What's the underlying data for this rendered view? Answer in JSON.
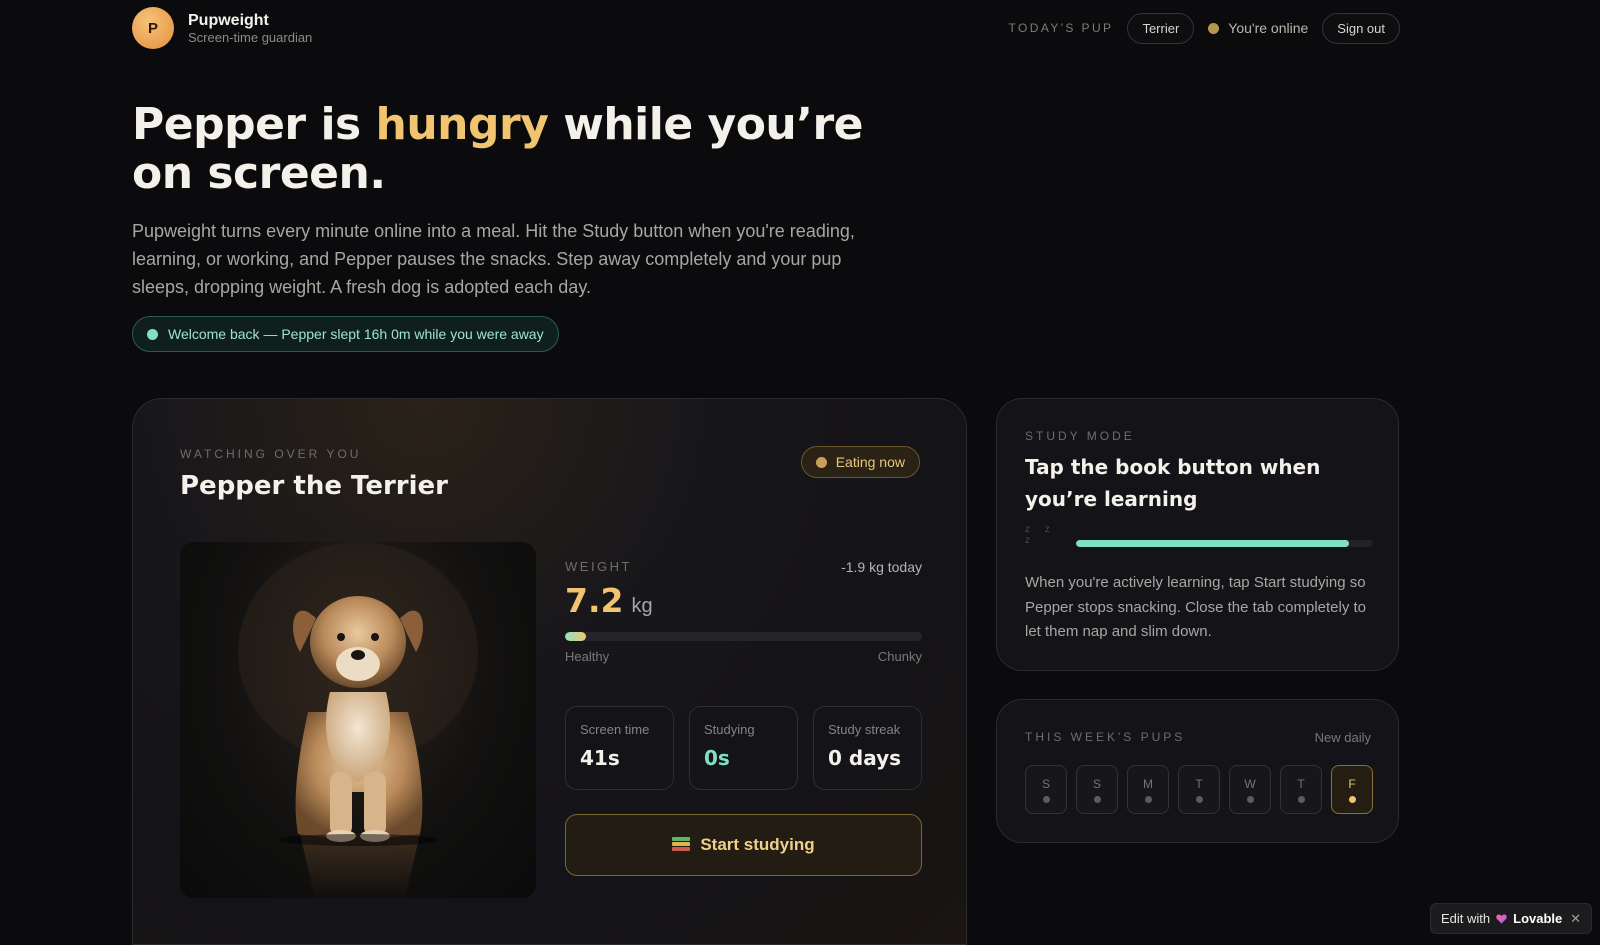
{
  "header": {
    "brand_initial": "P",
    "brand_name": "Pupweight",
    "brand_tagline": "Screen-time guardian",
    "todays_pup_label": "TODAY'S PUP",
    "breed_pill": "Terrier",
    "online_status": "You're online",
    "sign_out_label": "Sign out"
  },
  "hero": {
    "title_start": "Pepper is ",
    "title_accent": "hungry",
    "title_end": " while you’re on screen.",
    "subtitle": "Pupweight turns every minute online into a meal. Hit the Study button when you're reading, learning, or working, and Pepper pauses the snacks. Step away completely and your pup sleeps, dropping weight. A fresh dog is adopted each day.",
    "welcome_message": "Welcome back — Pepper slept 16h 0m while you were away"
  },
  "pet_card": {
    "eyebrow": "WATCHING OVER YOU",
    "pet_name": "Pepper the Terrier",
    "status_badge": "Eating now",
    "weight_label": "WEIGHT",
    "weight_delta": "-1.9 kg today",
    "weight_value": "7.2",
    "weight_unit": "kg",
    "weight_bar_fraction": 0.06,
    "scale_left": "Healthy",
    "scale_right": "Chunky",
    "stats": [
      {
        "label": "Screen time",
        "value": "41s"
      },
      {
        "label": "Studying",
        "value": "0s"
      },
      {
        "label": "Study streak",
        "value": "0 days"
      }
    ],
    "study_button_label": "Start studying",
    "study_button_icon": "books-icon"
  },
  "study_mode": {
    "eyebrow": "STUDY MODE",
    "title": "Tap the book button when you’re learning",
    "sleep_glyphs": "z z z",
    "progress_fraction": 0.92,
    "description": "When you're actively learning, tap Start studying so Pepper stops snacking. Close the tab completely to let them nap and slim down."
  },
  "week": {
    "eyebrow": "THIS WEEK'S PUPS",
    "new_daily": "New daily",
    "days": [
      "S",
      "S",
      "M",
      "T",
      "W",
      "T",
      "F"
    ],
    "active_index": 6
  },
  "badge": {
    "edit_with": "Edit with",
    "brand": "Lovable",
    "close": "✕"
  },
  "colors": {
    "accent_gold": "#f1c470",
    "accent_teal": "#7fe0c6",
    "background": "#0b0b0d"
  }
}
